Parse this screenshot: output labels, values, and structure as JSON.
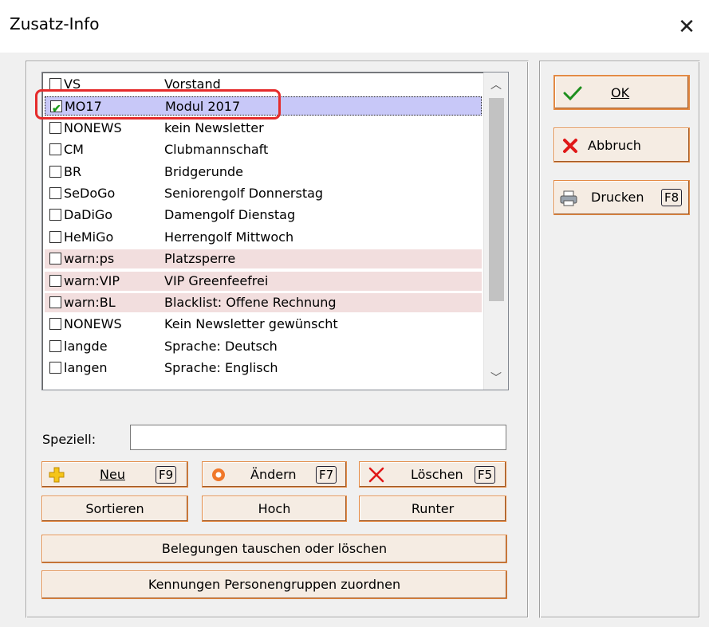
{
  "window": {
    "title": "Zusatz-Info",
    "close_glyph": "✕"
  },
  "list": {
    "rows": [
      {
        "code": "VS",
        "desc": "Vorstand",
        "checked": false,
        "state": "normal"
      },
      {
        "code": "MO17",
        "desc": "Modul 2017",
        "checked": true,
        "state": "selected"
      },
      {
        "code": "NONEWS",
        "desc": "kein Newsletter",
        "checked": false,
        "state": "normal"
      },
      {
        "code": "CM",
        "desc": "Clubmannschaft",
        "checked": false,
        "state": "normal"
      },
      {
        "code": "BR",
        "desc": "Bridgerunde",
        "checked": false,
        "state": "normal"
      },
      {
        "code": "SeDoGo",
        "desc": "Seniorengolf Donnerstag",
        "checked": false,
        "state": "normal"
      },
      {
        "code": "DaDiGo",
        "desc": "Damengolf Dienstag",
        "checked": false,
        "state": "normal"
      },
      {
        "code": "HeMiGo",
        "desc": "Herrengolf Mittwoch",
        "checked": false,
        "state": "normal"
      },
      {
        "code": "warn:ps",
        "desc": "Platzsperre",
        "checked": false,
        "state": "warn"
      },
      {
        "code": "warn:VIP",
        "desc": "VIP  Greenfeefrei",
        "checked": false,
        "state": "warn"
      },
      {
        "code": "warn:BL",
        "desc": "Blacklist: Offene Rechnung",
        "checked": false,
        "state": "warn"
      },
      {
        "code": "NONEWS",
        "desc": "Kein Newsletter gewünscht",
        "checked": false,
        "state": "normal"
      },
      {
        "code": "langde",
        "desc": "Sprache: Deutsch",
        "checked": false,
        "state": "normal"
      },
      {
        "code": "langen",
        "desc": "Sprache: Englisch",
        "checked": false,
        "state": "normal"
      }
    ]
  },
  "speziell": {
    "label": "Speziell:",
    "value": "",
    "placeholder": ""
  },
  "buttons": {
    "neu": {
      "label": "Neu",
      "fkey": "F9"
    },
    "aendern": {
      "label": "Ändern",
      "fkey": "F7"
    },
    "loeschen": {
      "label": "Löschen",
      "fkey": "F5"
    },
    "sortieren": {
      "label": "Sortieren"
    },
    "hoch": {
      "label": "Hoch"
    },
    "runter": {
      "label": "Runter"
    },
    "belegungen": {
      "label": "Belegungen tauschen oder löschen"
    },
    "kennungen": {
      "label": "Kennungen Personengruppen zuordnen"
    },
    "ok": {
      "label": "OK"
    },
    "abbruch": {
      "label": "Abbruch"
    },
    "drucken": {
      "label": "Drucken",
      "fkey": "F8"
    }
  },
  "colors": {
    "button_border": "#e38a44",
    "selection": "#c8c8f8",
    "warn_row": "#f2dede",
    "highlight_ring": "#e52b2b"
  },
  "icons": [
    "close-icon",
    "check-icon",
    "plus-icon",
    "edit-circle-icon",
    "delete-x-icon",
    "cross-icon",
    "printer-icon",
    "scroll-up-icon",
    "scroll-down-icon"
  ]
}
